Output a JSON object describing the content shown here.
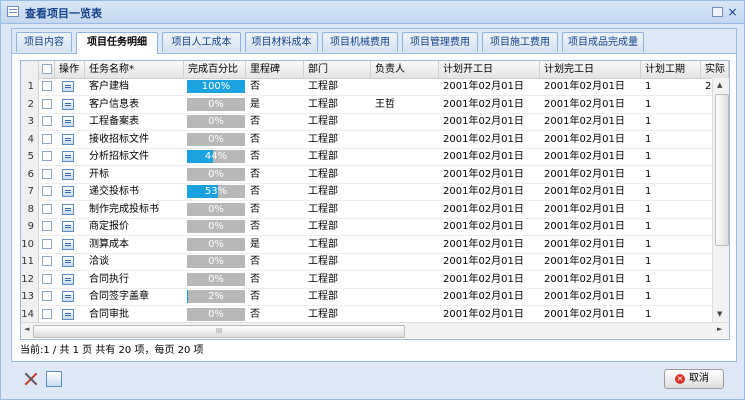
{
  "window": {
    "title": "查看项目一览表"
  },
  "tabs": [
    {
      "label": "项目内容",
      "active": false
    },
    {
      "label": "项目任务明细",
      "active": true
    },
    {
      "label": "项目人工成本",
      "active": false
    },
    {
      "label": "项目材料成本",
      "active": false
    },
    {
      "label": "项目机械费用",
      "active": false
    },
    {
      "label": "项目管理费用",
      "active": false
    },
    {
      "label": "项目施工费用",
      "active": false
    },
    {
      "label": "项目成品完成量",
      "active": false
    }
  ],
  "grid": {
    "columns": [
      "操作",
      "任务名称*",
      "完成百分比",
      "里程碑",
      "部门",
      "负责人",
      "计划开工日",
      "计划完工日",
      "计划工期",
      "实际"
    ],
    "rows": [
      {
        "num": "1",
        "name": "客户建档",
        "pct": 100,
        "pct_label": "100%",
        "milestone": "否",
        "dept": "工程部",
        "owner": "",
        "start": "2001年02月01日",
        "end": "2001年02月01日",
        "duration": "1",
        "actual": "2"
      },
      {
        "num": "2",
        "name": "客户信息表",
        "pct": 0,
        "pct_label": "0%",
        "milestone": "是",
        "dept": "工程部",
        "owner": "王哲",
        "start": "2001年02月01日",
        "end": "2001年02月01日",
        "duration": "1",
        "actual": ""
      },
      {
        "num": "3",
        "name": "工程备案表",
        "pct": 0,
        "pct_label": "0%",
        "milestone": "否",
        "dept": "工程部",
        "owner": "",
        "start": "2001年02月01日",
        "end": "2001年02月01日",
        "duration": "1",
        "actual": ""
      },
      {
        "num": "4",
        "name": "接收招标文件",
        "pct": 0,
        "pct_label": "0%",
        "milestone": "否",
        "dept": "工程部",
        "owner": "",
        "start": "2001年02月01日",
        "end": "2001年02月01日",
        "duration": "1",
        "actual": ""
      },
      {
        "num": "5",
        "name": "分析招标文件",
        "pct": 44,
        "pct_label": "44%",
        "milestone": "否",
        "dept": "工程部",
        "owner": "",
        "start": "2001年02月01日",
        "end": "2001年02月01日",
        "duration": "1",
        "actual": ""
      },
      {
        "num": "6",
        "name": "开标",
        "pct": 0,
        "pct_label": "0%",
        "milestone": "否",
        "dept": "工程部",
        "owner": "",
        "start": "2001年02月01日",
        "end": "2001年02月01日",
        "duration": "1",
        "actual": ""
      },
      {
        "num": "7",
        "name": "递交投标书",
        "pct": 53,
        "pct_label": "53%",
        "milestone": "否",
        "dept": "工程部",
        "owner": "",
        "start": "2001年02月01日",
        "end": "2001年02月01日",
        "duration": "1",
        "actual": ""
      },
      {
        "num": "8",
        "name": "制作完成投标书",
        "pct": 0,
        "pct_label": "0%",
        "milestone": "否",
        "dept": "工程部",
        "owner": "",
        "start": "2001年02月01日",
        "end": "2001年02月01日",
        "duration": "1",
        "actual": ""
      },
      {
        "num": "9",
        "name": "商定报价",
        "pct": 0,
        "pct_label": "0%",
        "milestone": "否",
        "dept": "工程部",
        "owner": "",
        "start": "2001年02月01日",
        "end": "2001年02月01日",
        "duration": "1",
        "actual": ""
      },
      {
        "num": "10",
        "name": "测算成本",
        "pct": 0,
        "pct_label": "0%",
        "milestone": "是",
        "dept": "工程部",
        "owner": "",
        "start": "2001年02月01日",
        "end": "2001年02月01日",
        "duration": "1",
        "actual": ""
      },
      {
        "num": "11",
        "name": "洽谈",
        "pct": 0,
        "pct_label": "0%",
        "milestone": "否",
        "dept": "工程部",
        "owner": "",
        "start": "2001年02月01日",
        "end": "2001年02月01日",
        "duration": "1",
        "actual": ""
      },
      {
        "num": "12",
        "name": "合同执行",
        "pct": 0,
        "pct_label": "0%",
        "milestone": "否",
        "dept": "工程部",
        "owner": "",
        "start": "2001年02月01日",
        "end": "2001年02月01日",
        "duration": "1",
        "actual": ""
      },
      {
        "num": "13",
        "name": "合同签字盖章",
        "pct": 2,
        "pct_label": "2%",
        "milestone": "否",
        "dept": "工程部",
        "owner": "",
        "start": "2001年02月01日",
        "end": "2001年02月01日",
        "duration": "1",
        "actual": ""
      },
      {
        "num": "14",
        "name": "合同审批",
        "pct": 0,
        "pct_label": "0%",
        "milestone": "否",
        "dept": "工程部",
        "owner": "",
        "start": "2001年02月01日",
        "end": "2001年02月01日",
        "duration": "1",
        "actual": ""
      }
    ]
  },
  "pager": {
    "text": "当前:1 / 共 1 页 共有 20 项，每页 20 项"
  },
  "footer": {
    "cancel_label": "取消"
  },
  "colors": {
    "progress_fill": "#1aa3e0",
    "progress_empty": "#b8b8b8",
    "border": "#99bbe8"
  }
}
